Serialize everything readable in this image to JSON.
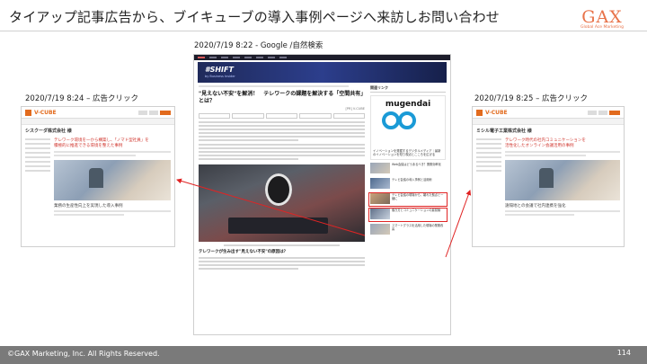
{
  "header": {
    "title": "タイアップ記事広告から、ブイキューブの導入事例ページへ来訪しお問い合わせ",
    "logo_text": "GAX",
    "logo_sub": "Global Ace Marketing"
  },
  "captions": {
    "center": "2020/7/19 8:22 - Google /自然検索",
    "left": "2020/7/19 8:24 – 広告クリック",
    "right": "2020/7/19 8:25 – 広告クリック"
  },
  "left_page": {
    "brand": "V-CUBE",
    "heading": "シスクーダ株式会社 様",
    "red_lines": [
      "テレワーク環境を一から構築し、「ノマド型社員」を",
      "積極的に推進できる環境を整えた事例"
    ],
    "photo_caption": "業務の生産性向上を実現した導入事例"
  },
  "right_page": {
    "brand": "V-CUBE",
    "heading": "ミシル電子工業株式会社 様",
    "red_lines": [
      "テレワーク時代の社内コミュニケーションを",
      "活性化したオンライン会議活用の事例"
    ],
    "photo_caption": "遠隔地との会議で社内連携を強化"
  },
  "article": {
    "banner_title": "#SHIFT",
    "banner_sub": "by Business Insider",
    "headline": "\"見えない不安\"を解消！　テレワークの課題を解決する「空間共有」とは？",
    "byline": "[PR] V-CUBE",
    "subheading": "テレワークが生み出す\"見えない不安\"の原因は？",
    "side_label": "関連リンク",
    "ad_title": "mugendai",
    "ad_text": "イノベーションを発掘するデジタルメディア｜最新のイノベーションを知り視点とこころを広げる",
    "side_items": [
      "Web会議はどうあるべき？業務効率化",
      "テレビ会議の導入事例と活用術",
      "テレビ会議の現場から、離れた拠点と一緒に",
      "働き方とコミュニケーションの最前線",
      "スマートグラスを活用した現場の業務改善"
    ]
  },
  "footer": {
    "copyright": "©GAX Marketing, Inc. All Rights Reserved.",
    "page_number": "114"
  }
}
